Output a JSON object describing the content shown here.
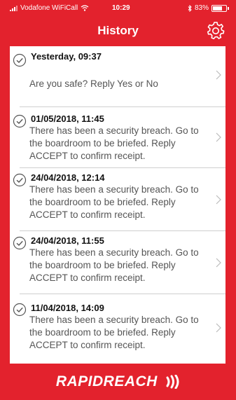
{
  "status_bar": {
    "carrier": "Vodafone WiFiCall",
    "time": "10:29",
    "battery": "83%",
    "battery_level": 0.83,
    "icons": [
      "signal-icon",
      "wifi-icon",
      "bluetooth-icon",
      "battery-icon"
    ]
  },
  "header": {
    "title": "History",
    "settings_icon": "gear-icon"
  },
  "messages": [
    {
      "datetime": "Yesterday, 09:37",
      "body": "Are you safe? Reply Yes or No"
    },
    {
      "datetime": "01/05/2018, 11:45",
      "body": "There has been a security breach. Go to the boardroom to be briefed. Reply ACCEPT  to confirm receipt."
    },
    {
      "datetime": "24/04/2018, 12:14",
      "body": "There has been a security breach. Go to the boardroom to be briefed. Reply ACCEPT  to confirm receipt."
    },
    {
      "datetime": "24/04/2018, 11:55",
      "body": "There has been a security breach. Go to the boardroom to be briefed. Reply ACCEPT  to confirm receipt."
    },
    {
      "datetime": "11/04/2018, 14:09",
      "body": "There has been a security breach. Go to the boardroom to be briefed. Reply ACCEPT  to confirm receipt."
    }
  ],
  "footer": {
    "logo_text": "RapidReach"
  },
  "colors": {
    "brand_red": "#e3222d",
    "panel": "#ffffff",
    "text_dark": "#111111",
    "text_body": "#555555"
  }
}
